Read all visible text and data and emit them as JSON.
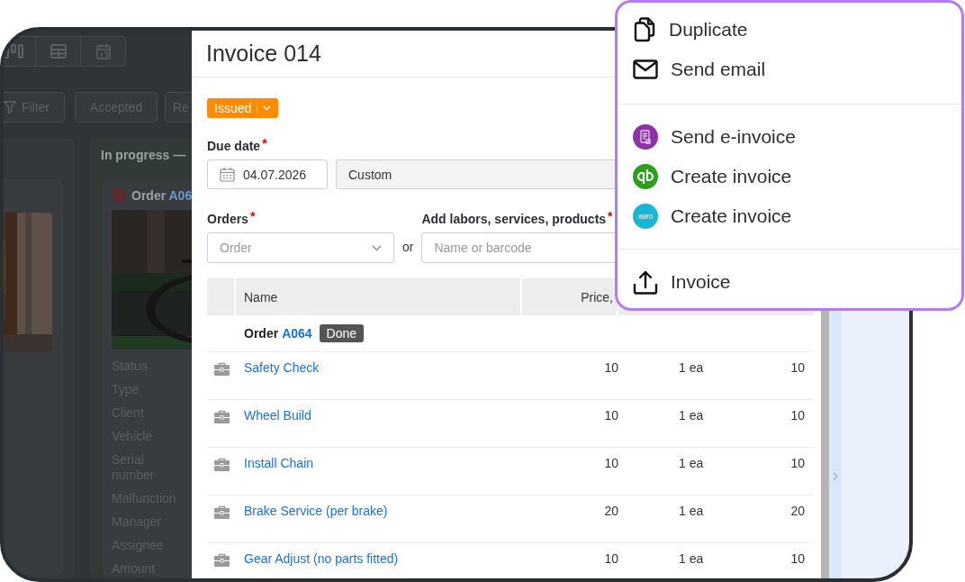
{
  "toolbar": {
    "filters": [
      {
        "kind": "filter",
        "label": "Filter"
      },
      {
        "kind": "plain",
        "label": "Accepted"
      },
      {
        "kind": "plain",
        "label": "Re"
      }
    ]
  },
  "board": {
    "columns": [
      {
        "cards": [
          {
            "kind": "picture"
          }
        ]
      },
      {
        "title": "In progress —",
        "cards": [
          {
            "kind": "order",
            "order": "Order",
            "link": "A06",
            "fields": [
              "Status",
              "Type",
              "Client",
              "Vehicle",
              "Serial number",
              "Malfunction",
              "Manager",
              "Assignee",
              "Amount"
            ]
          }
        ]
      }
    ]
  },
  "invoice": {
    "title": "Invoice 014",
    "status": "Issued",
    "due_date": {
      "label": "Due date",
      "mark": "*",
      "value": "04.07.2026",
      "term": "Custom"
    },
    "orders": {
      "label": "Orders",
      "mark": "*",
      "placeholder": "Order"
    },
    "or": "or",
    "add": {
      "label": "Add labors, services, products",
      "mark": "*",
      "placeholder": "Name or barcode"
    },
    "table": {
      "columns": [
        "Name",
        "Price,"
      ],
      "group": {
        "label": "Order",
        "link": "A064",
        "status": "Done"
      },
      "rows": [
        {
          "name": "Safety Check",
          "price": "10",
          "qty": "1 ea",
          "amount": "10"
        },
        {
          "name": "Wheel Build",
          "price": "10",
          "qty": "1 ea",
          "amount": "10"
        },
        {
          "name": "Install Chain",
          "price": "10",
          "qty": "1 ea",
          "amount": "10"
        },
        {
          "name": "Brake Service (per brake)",
          "price": "20",
          "qty": "1 ea",
          "amount": "20"
        },
        {
          "name": "Gear Adjust (no parts fitted)",
          "price": "10",
          "qty": "1 ea",
          "amount": "10"
        }
      ]
    }
  },
  "menu": {
    "sections": [
      [
        {
          "kind": "duplicate",
          "label": "Duplicate"
        },
        {
          "kind": "email",
          "label": "Send email"
        }
      ],
      [
        {
          "kind": "einvoice",
          "label": "Send e-invoice"
        },
        {
          "kind": "quickbooks",
          "label": "Create invoice"
        },
        {
          "kind": "xero",
          "label": "Create invoice",
          "logo_text": "xero"
        }
      ],
      [
        {
          "kind": "upload",
          "label": "Invoice"
        }
      ]
    ]
  }
}
